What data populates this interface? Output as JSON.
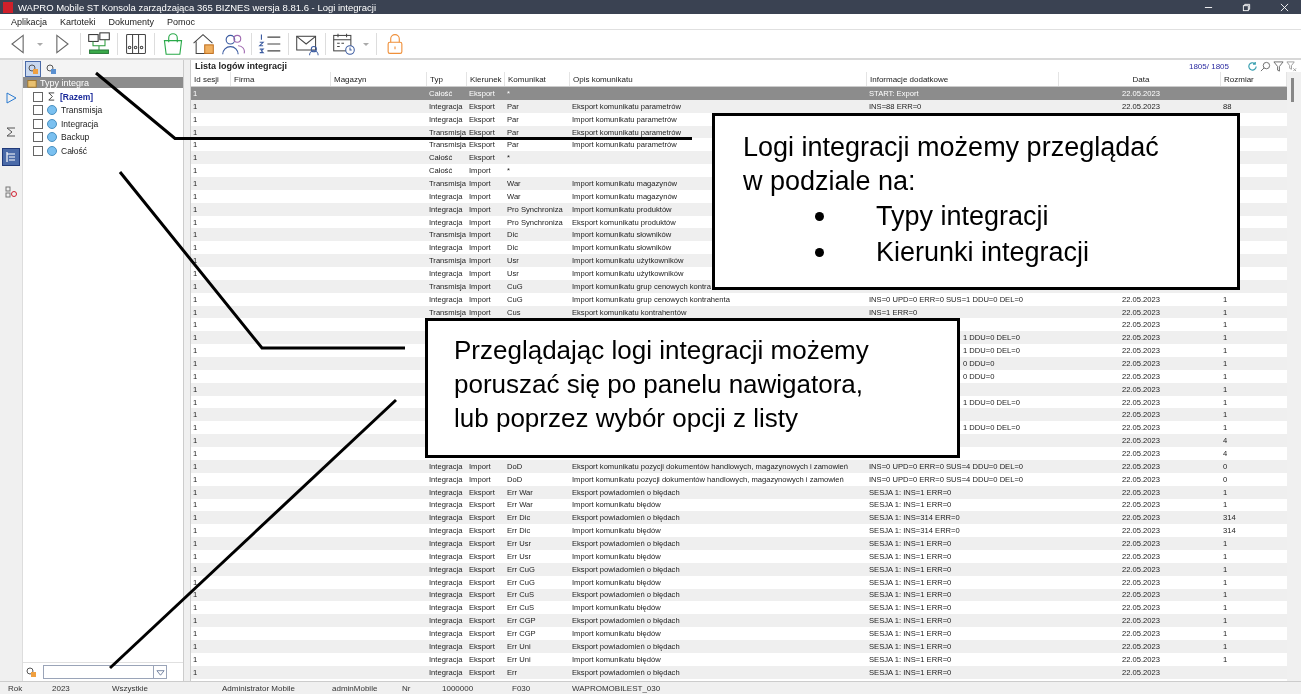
{
  "window": {
    "title": "WAPRO Mobile ST Konsola zarządzająca 365 BIZNES wersja 8.81.6 - Logi integracji"
  },
  "menu": [
    "Aplikacja",
    "Kartoteki",
    "Dokumenty",
    "Pomoc"
  ],
  "toolbar": [
    {
      "kind": "back"
    },
    {
      "kind": "caret"
    },
    {
      "kind": "forward"
    },
    {
      "kind": "network"
    },
    {
      "kind": "binders"
    },
    {
      "kind": "bag"
    },
    {
      "kind": "house"
    },
    {
      "kind": "users"
    },
    {
      "kind": "list"
    },
    {
      "kind": "envelope"
    },
    {
      "kind": "calendar"
    },
    {
      "kind": "caret"
    },
    {
      "kind": "lock"
    }
  ],
  "side_strip": [
    {
      "kind": "play",
      "selected": false
    },
    {
      "kind": "sigma",
      "selected": false
    },
    {
      "kind": "tree",
      "selected": true
    },
    {
      "kind": "checklist",
      "selected": false
    }
  ],
  "nav": {
    "tabs": [
      {
        "selected": true
      },
      {
        "selected": false
      }
    ],
    "header": "Typy integra",
    "items": [
      {
        "label": "[Razem]",
        "kind": "sum",
        "checked": false
      },
      {
        "label": "Transmisja",
        "kind": "group",
        "checked": false
      },
      {
        "label": "Integracja",
        "kind": "group",
        "checked": false
      },
      {
        "label": "Backup",
        "kind": "group",
        "checked": false
      },
      {
        "label": "Całość",
        "kind": "group",
        "checked": false
      }
    ]
  },
  "table": {
    "title": "Lista logów integracji",
    "count": "1805/ 1805",
    "columns": [
      "Id sesji",
      "Firma",
      "Magazyn",
      "Typ",
      "Kierunek",
      "Komunikat",
      "Opis komunikatu",
      "Informacje dodatkowe",
      "Data",
      "Rozmiar"
    ],
    "rows": [
      {
        "id": "1",
        "typ": "Całość",
        "kierunek": "Eksport",
        "komunikat": "*",
        "info": "START: Export",
        "data": "22.05.2023",
        "selected": true
      },
      {
        "id": "1",
        "typ": "Integracja",
        "kierunek": "Eksport",
        "komunikat": "Par",
        "opis": "Eksport komunikatu parametrów",
        "info": "INS=88 ERR=0",
        "data": "22.05.2023",
        "rozmiar": "88",
        "selected": false
      },
      {
        "id": "1",
        "typ": "Integracja",
        "kierunek": "Eksport",
        "komunikat": "Par",
        "opis": "Import komunikatu parametrów",
        "selected": false
      },
      {
        "id": "1",
        "typ": "Transmisja",
        "kierunek": "Eksport",
        "komunikat": "Par",
        "opis": "Eksport komunikatu parametrów",
        "selected": false
      },
      {
        "id": "1",
        "typ": "Transmisja",
        "kierunek": "Eksport",
        "komunikat": "Par",
        "opis": "Import komunikatu parametrów",
        "selected": false
      },
      {
        "id": "1",
        "typ": "Całość",
        "kierunek": "Eksport",
        "komunikat": "*",
        "selected": false
      },
      {
        "id": "1",
        "typ": "Całość",
        "kierunek": "Import",
        "komunikat": "*",
        "selected": false
      },
      {
        "id": "1",
        "typ": "Transmisja",
        "kierunek": "Import",
        "komunikat": "War",
        "opis": "Import komunikatu magazynów",
        "selected": false
      },
      {
        "id": "1",
        "typ": "Integracja",
        "kierunek": "Import",
        "komunikat": "War",
        "opis": "Import komunikatu magazynów",
        "selected": false
      },
      {
        "id": "1",
        "typ": "Integracja",
        "kierunek": "Import",
        "komunikat": "Pro Synchroniza",
        "opis": "Import komunikatu produktów",
        "selected": false
      },
      {
        "id": "1",
        "typ": "Integracja",
        "kierunek": "Import",
        "komunikat": "Pro Synchroniza",
        "opis": "Eksport komunikatu produktów",
        "selected": false
      },
      {
        "id": "1",
        "typ": "Transmisja",
        "kierunek": "Import",
        "komunikat": "Dic",
        "opis": "Import komunikatu słowników",
        "selected": false
      },
      {
        "id": "1",
        "typ": "Integracja",
        "kierunek": "Import",
        "komunikat": "Dic",
        "opis": "Import komunikatu słowników",
        "selected": false
      },
      {
        "id": "1",
        "typ": "Transmisja",
        "kierunek": "Import",
        "komunikat": "Usr",
        "opis": "Import komunikatu użytkowników",
        "selected": false
      },
      {
        "id": "1",
        "typ": "Integracja",
        "kierunek": "Import",
        "komunikat": "Usr",
        "opis": "Import komunikatu użytkowników",
        "selected": false
      },
      {
        "id": "1",
        "typ": "Transmisja",
        "kierunek": "Import",
        "komunikat": "CuG",
        "opis": "Import komunikatu grup cenowych kontra",
        "selected": false
      },
      {
        "id": "1",
        "typ": "Integracja",
        "kierunek": "Import",
        "komunikat": "CuG",
        "opis": "Import komunikatu grup cenowych kontrahenta",
        "info": "INS=0 UPD=0 ERR=0 SUS=1 DDU=0 DEL=0",
        "data": "22.05.2023",
        "rozmiar": "1",
        "selected": false
      },
      {
        "id": "1",
        "typ": "Transmisja",
        "kierunek": "Import",
        "komunikat": "Cus",
        "opis": "Eksport komunikatu kontrahentów",
        "info": "INS=1 ERR=0",
        "data": "22.05.2023",
        "rozmiar": "1",
        "selected": false
      },
      {
        "id": "1",
        "data": "22.05.2023",
        "rozmiar": "1",
        "selected": false
      },
      {
        "id": "1",
        "info": "1 DDU=0 DEL=0",
        "data": "22.05.2023",
        "rozmiar": "1",
        "selected": false
      },
      {
        "id": "1",
        "info": "1 DDU=0 DEL=0",
        "data": "22.05.2023",
        "rozmiar": "1",
        "selected": false
      },
      {
        "id": "1",
        "info": "0 DDU=0",
        "data": "22.05.2023",
        "rozmiar": "1",
        "selected": false
      },
      {
        "id": "1",
        "info": "0 DDU=0",
        "data": "22.05.2023",
        "rozmiar": "1",
        "selected": false
      },
      {
        "id": "1",
        "data": "22.05.2023",
        "rozmiar": "1",
        "selected": false
      },
      {
        "id": "1",
        "info": "1 DDU=0 DEL=0",
        "data": "22.05.2023",
        "rozmiar": "1",
        "selected": false
      },
      {
        "id": "1",
        "data": "22.05.2023",
        "rozmiar": "1",
        "selected": false
      },
      {
        "id": "1",
        "info": "1 DDU=0 DEL=0",
        "data": "22.05.2023",
        "rozmiar": "1",
        "selected": false
      },
      {
        "id": "1",
        "data": "22.05.2023",
        "rozmiar": "4",
        "selected": false
      },
      {
        "id": "1",
        "data": "22.05.2023",
        "rozmiar": "4",
        "selected": false
      },
      {
        "id": "1",
        "typ": "Integracja",
        "kierunek": "Import",
        "komunikat": "DoD",
        "opis": "Eksport komunikatu pozycji dokumentów handlowych, magazynowych i zamowień",
        "info": "INS=0 UPD=0 ERR=0 SUS=4 DDU=0 DEL=0",
        "data": "22.05.2023",
        "rozmiar": "0",
        "selected": false
      },
      {
        "id": "1",
        "typ": "Integracja",
        "kierunek": "Import",
        "komunikat": "DoD",
        "opis": "Import komunikatu pozycji dokumentów handlowych, magazynowych i zamowień",
        "info": "INS=0 UPD=0 ERR=0 SUS=4 DDU=0 DEL=0",
        "data": "22.05.2023",
        "rozmiar": "0",
        "selected": false
      },
      {
        "id": "1",
        "typ": "Integracja",
        "kierunek": "Eksport",
        "komunikat": "Err War",
        "opis": "Eksport powiadomień o błędach",
        "info": "SESJA 1: INS=1 ERR=0",
        "data": "22.05.2023",
        "rozmiar": "1",
        "selected": false
      },
      {
        "id": "1",
        "typ": "Integracja",
        "kierunek": "Eksport",
        "komunikat": "Err War",
        "opis": "Import komunikatu błędów",
        "info": "SESJA 1: INS=1 ERR=0",
        "data": "22.05.2023",
        "rozmiar": "1",
        "selected": false
      },
      {
        "id": "1",
        "typ": "Integracja",
        "kierunek": "Eksport",
        "komunikat": "Err Dic",
        "opis": "Eksport powiadomień o błędach",
        "info": "SESJA 1: INS=314 ERR=0",
        "data": "22.05.2023",
        "rozmiar": "314",
        "selected": false
      },
      {
        "id": "1",
        "typ": "Integracja",
        "kierunek": "Eksport",
        "komunikat": "Err Dic",
        "opis": "Import komunikatu błędów",
        "info": "SESJA 1: INS=314 ERR=0",
        "data": "22.05.2023",
        "rozmiar": "314",
        "selected": false
      },
      {
        "id": "1",
        "typ": "Integracja",
        "kierunek": "Eksport",
        "komunikat": "Err Usr",
        "opis": "Eksport powiadomień o błędach",
        "info": "SESJA 1: INS=1 ERR=0",
        "data": "22.05.2023",
        "rozmiar": "1",
        "selected": false
      },
      {
        "id": "1",
        "typ": "Integracja",
        "kierunek": "Eksport",
        "komunikat": "Err Usr",
        "opis": "Import komunikatu błędów",
        "info": "SESJA 1: INS=1 ERR=0",
        "data": "22.05.2023",
        "rozmiar": "1",
        "selected": false
      },
      {
        "id": "1",
        "typ": "Integracja",
        "kierunek": "Eksport",
        "komunikat": "Err CuG",
        "opis": "Eksport powiadomień o błędach",
        "info": "SESJA 1: INS=1 ERR=0",
        "data": "22.05.2023",
        "rozmiar": "1",
        "selected": false
      },
      {
        "id": "1",
        "typ": "Integracja",
        "kierunek": "Eksport",
        "komunikat": "Err CuG",
        "opis": "Import komunikatu błędów",
        "info": "SESJA 1: INS=1 ERR=0",
        "data": "22.05.2023",
        "rozmiar": "1",
        "selected": false
      },
      {
        "id": "1",
        "typ": "Integracja",
        "kierunek": "Eksport",
        "komunikat": "Err CuS",
        "opis": "Eksport powiadomień o błędach",
        "info": "SESJA 1: INS=1 ERR=0",
        "data": "22.05.2023",
        "rozmiar": "1",
        "selected": false
      },
      {
        "id": "1",
        "typ": "Integracja",
        "kierunek": "Eksport",
        "komunikat": "Err CuS",
        "opis": "Import komunikatu błędów",
        "info": "SESJA 1: INS=1 ERR=0",
        "data": "22.05.2023",
        "rozmiar": "1",
        "selected": false
      },
      {
        "id": "1",
        "typ": "Integracja",
        "kierunek": "Eksport",
        "komunikat": "Err CGP",
        "opis": "Eksport powiadomień o błędach",
        "info": "SESJA 1: INS=1 ERR=0",
        "data": "22.05.2023",
        "rozmiar": "1",
        "selected": false
      },
      {
        "id": "1",
        "typ": "Integracja",
        "kierunek": "Eksport",
        "komunikat": "Err CGP",
        "opis": "Import komunikatu błędów",
        "info": "SESJA 1: INS=1 ERR=0",
        "data": "22.05.2023",
        "rozmiar": "1",
        "selected": false
      },
      {
        "id": "1",
        "typ": "Integracja",
        "kierunek": "Eksport",
        "komunikat": "Err Uni",
        "opis": "Eksport powiadomień o błędach",
        "info": "SESJA 1: INS=1 ERR=0",
        "data": "22.05.2023",
        "rozmiar": "1",
        "selected": false
      },
      {
        "id": "1",
        "typ": "Integracja",
        "kierunek": "Eksport",
        "komunikat": "Err Uni",
        "opis": "Import komunikatu błędów",
        "info": "SESJA 1: INS=1 ERR=0",
        "data": "22.05.2023",
        "rozmiar": "1",
        "selected": false
      },
      {
        "id": "1",
        "typ": "Integracja",
        "kierunek": "Eksport",
        "komunikat": "Err",
        "opis": "Eksport powiadomień o błędach",
        "info": "SESJA 1: INS=1 ERR=0",
        "data": "22.05.2023",
        "selected": false
      }
    ]
  },
  "status_bar": [
    "Rok",
    "2023",
    "Wszystkie",
    "Administrator Mobile",
    "adminMobile",
    "Nr",
    "1000000",
    "F030",
    "WAPROMOBILEST_030"
  ],
  "callouts": [
    {
      "lines": [
        "Logi integracji możemy przeglądać",
        "w podziale na:"
      ],
      "bullets": [
        "Typy integracji",
        "Kierunki integracji"
      ]
    },
    {
      "lines": [
        "Przeglądając logi integracji możemy",
        "poruszać się po panelu nawigatora,",
        "lub poprzez wybór opcji z listy"
      ]
    }
  ]
}
